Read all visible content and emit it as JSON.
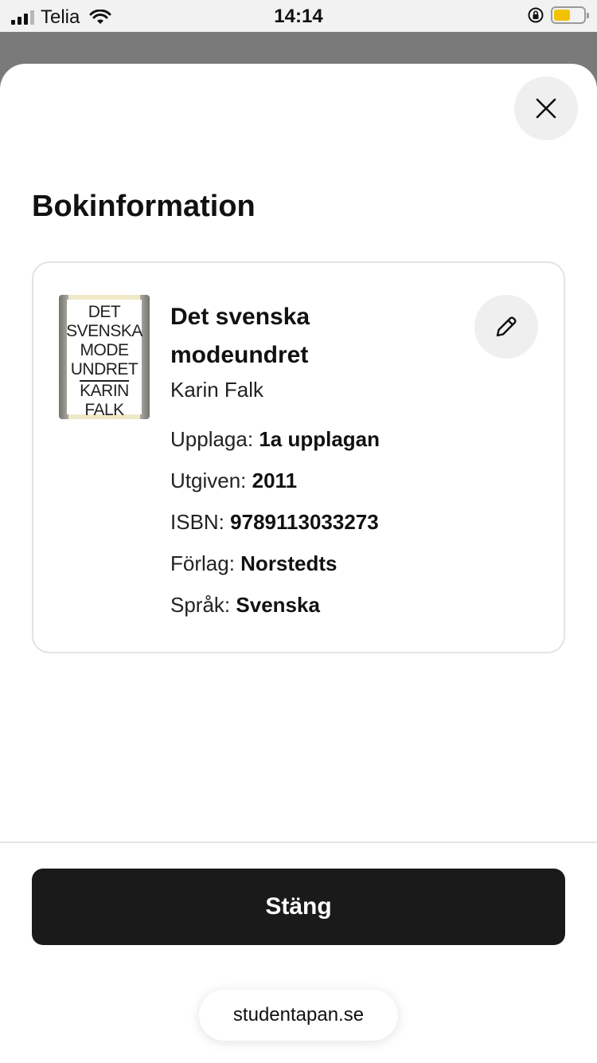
{
  "status_bar": {
    "carrier": "Telia",
    "time": "14:14",
    "battery_color": "#f2c200"
  },
  "sheet": {
    "title": "Bokinformation",
    "close_icon": "close-icon"
  },
  "book": {
    "cover_lines": [
      "DET",
      "SVENSKA",
      "MODE",
      "UNDRET"
    ],
    "cover_author_lines": [
      "KARIN",
      "FALK"
    ],
    "title": "Det svenska modeundret",
    "author": "Karin Falk",
    "edit_icon": "pencil-icon",
    "details": [
      {
        "label": "Upplaga:",
        "value": "1a upplagan"
      },
      {
        "label": "Utgiven:",
        "value": "2011"
      },
      {
        "label": "ISBN:",
        "value": "9789113033273"
      },
      {
        "label": "Förlag:",
        "value": "Norstedts"
      },
      {
        "label": "Språk:",
        "value": "Svenska"
      }
    ]
  },
  "footer": {
    "close_button_label": "Stäng",
    "url": "studentapan.se"
  }
}
